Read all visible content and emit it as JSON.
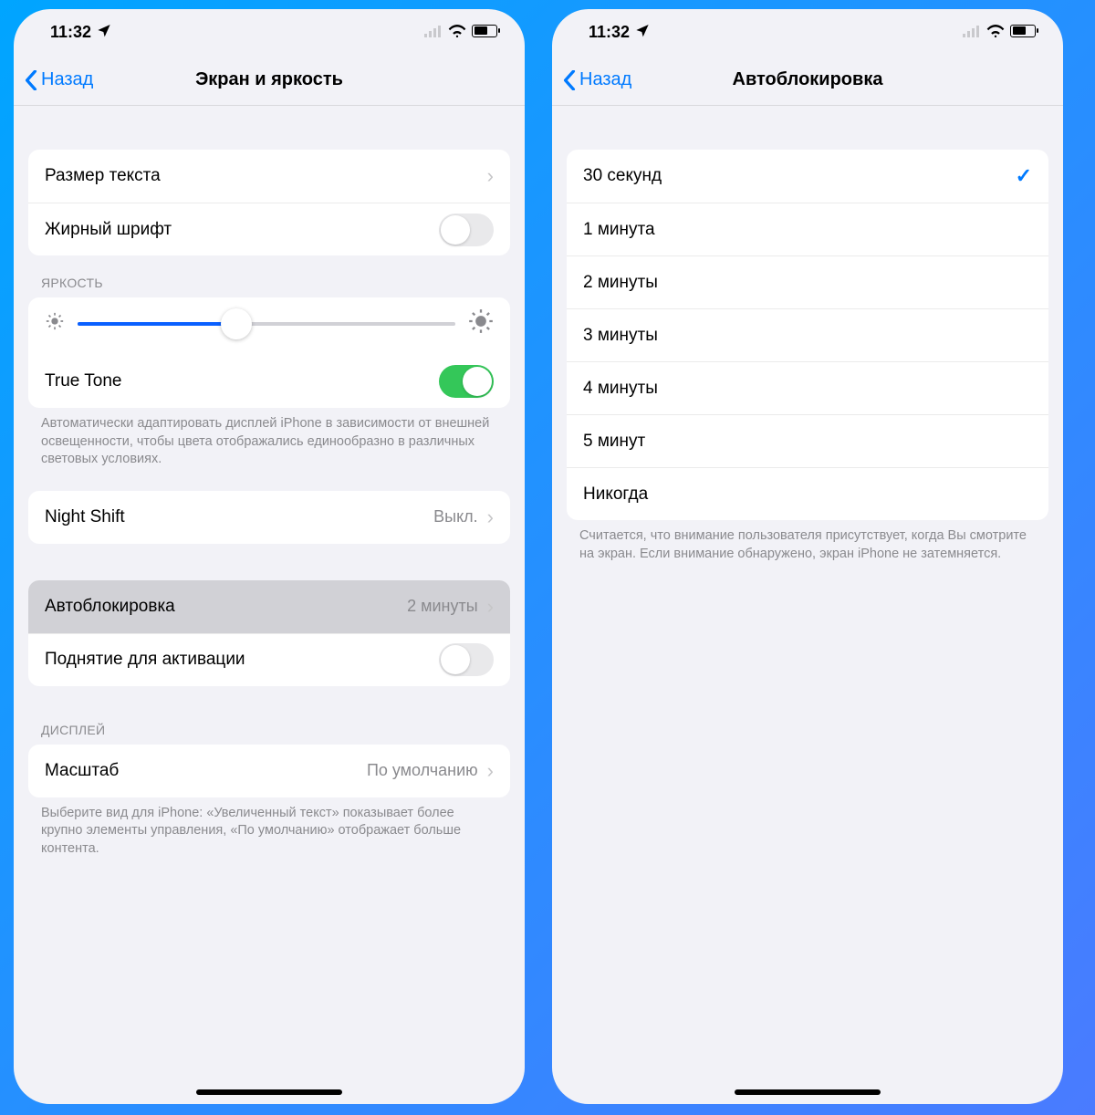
{
  "status": {
    "time": "11:32",
    "location_icon": "location-arrow"
  },
  "left": {
    "back_label": "Назад",
    "title": "Экран и яркость",
    "text_size": {
      "label": "Размер текста"
    },
    "bold_text": {
      "label": "Жирный шрифт",
      "on": false
    },
    "brightness_header": "ЯРКОСТЬ",
    "brightness_percent": 42,
    "true_tone": {
      "label": "True Tone",
      "on": true
    },
    "true_tone_footer": "Автоматически адаптировать дисплей iPhone в зависимости от внешней освещенности, чтобы цвета отображались единообразно в различных световых условиях.",
    "night_shift": {
      "label": "Night Shift",
      "value": "Выкл."
    },
    "auto_lock": {
      "label": "Автоблокировка",
      "value": "2 минуты"
    },
    "raise_to_wake": {
      "label": "Поднятие для активации",
      "on": false
    },
    "display_header": "ДИСПЛЕЙ",
    "zoom": {
      "label": "Масштаб",
      "value": "По умолчанию"
    },
    "zoom_footer": "Выберите вид для iPhone: «Увеличенный текст» показывает более крупно элементы управления, «По умолчанию» отображает больше контента."
  },
  "right": {
    "back_label": "Назад",
    "title": "Автоблокировка",
    "options": [
      {
        "label": "30 секунд",
        "selected": true
      },
      {
        "label": "1 минута",
        "selected": false
      },
      {
        "label": "2 минуты",
        "selected": false
      },
      {
        "label": "3 минуты",
        "selected": false
      },
      {
        "label": "4 минуты",
        "selected": false
      },
      {
        "label": "5 минут",
        "selected": false
      },
      {
        "label": "Никогда",
        "selected": false
      }
    ],
    "footer": "Считается, что внимание пользователя присутствует, когда Вы смотрите на экран. Если внимание обнаружено, экран iPhone не затемняется."
  }
}
